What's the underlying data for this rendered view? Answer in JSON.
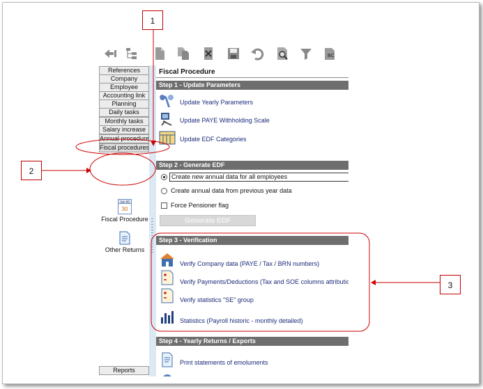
{
  "toolbar": {
    "icons": [
      "navigate-back-icon",
      "tree-icon",
      "new-document-icon",
      "copy-document-icon",
      "delete-icon",
      "save-icon",
      "undo-icon",
      "search-document-icon",
      "filter-icon",
      "sort-abc-icon"
    ]
  },
  "sidebar": {
    "items": [
      {
        "label": "References"
      },
      {
        "label": "Company"
      },
      {
        "label": "Employee"
      },
      {
        "label": "Accounting link"
      },
      {
        "label": "Planning"
      },
      {
        "label": "Daily tasks"
      },
      {
        "label": "Monthly tasks"
      },
      {
        "label": "Salary increase"
      },
      {
        "label": "Annual procedures"
      },
      {
        "label": "Fiscal procedures"
      }
    ],
    "calendar_icon": {
      "month": "Jun 06",
      "day": "30"
    },
    "fiscal_procedure_label": "Fiscal Procedure",
    "other_returns_label": "Other Returns",
    "reports_label": "Reports"
  },
  "content": {
    "title": "Fiscal Procedure",
    "step1": {
      "header": "Step 1 - Update Parameters",
      "links": [
        "Update Yearly Parameters",
        "Update PAYE Withholding Scale",
        "Update EDF Categories"
      ]
    },
    "step2": {
      "header": "Step 2 - Generate EDF",
      "options": [
        "Create new annual data for all employees",
        "Create annual data from previous year data"
      ],
      "selected_option": "Create new annual data for all employees",
      "checkbox_label": "Force Pensioner flag",
      "checkbox_checked": false,
      "button_label": "Generate EDF"
    },
    "step3": {
      "header": "Step 3 - Verification",
      "links": [
        "Verify Company data (PAYE / Tax / BRN numbers)",
        "Verify Payments/Deductions (Tax and SOE columns attributions)",
        "Verify statistics \"SE\" group",
        "Statistics (Payroll historic - monthly detailed)"
      ]
    },
    "step4": {
      "header": "Step 4 - Yearly Returns / Exports",
      "links": [
        "Print statements of emoluments"
      ]
    }
  },
  "annotations": {
    "callout_1": "1",
    "callout_2": "2",
    "callout_3": "3",
    "color": "#cc0000"
  }
}
